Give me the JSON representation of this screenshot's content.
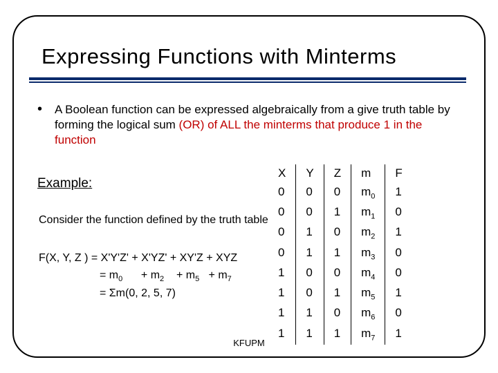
{
  "title": "Expressing Functions with Minterms",
  "bullet": {
    "pre": "A Boolean function can be expressed algebraically from a give truth table by forming the logical sum ",
    "or": "(OR) of ALL the minterms that produce ",
    "one": "1 in the function"
  },
  "example_label": "Example:",
  "consider": "Consider the function defined by the truth table",
  "fx": {
    "line1": "F(X, Y, Z ) =  X'Y'Z' + X'YZ' + XY'Z + XYZ",
    "line2_pre": "= m",
    "line2_s0": "0",
    "line2_mid1": "      + m",
    "line2_s2": "2",
    "line2_mid2": "    + m",
    "line2_s5": "5",
    "line2_mid3": "   + m",
    "line2_s7": "7",
    "line3": "= Σm(0, 2, 5, 7)"
  },
  "table": {
    "headers": [
      "X",
      "Y",
      "Z",
      "m",
      "F"
    ],
    "rows": [
      {
        "x": "0",
        "y": "0",
        "z": "0",
        "m": "m",
        "mi": "0",
        "f": "1"
      },
      {
        "x": "0",
        "y": "0",
        "z": "1",
        "m": "m",
        "mi": "1",
        "f": "0"
      },
      {
        "x": "0",
        "y": "1",
        "z": "0",
        "m": "m",
        "mi": "2",
        "f": "1"
      },
      {
        "x": "0",
        "y": "1",
        "z": "1",
        "m": "m",
        "mi": "3",
        "f": "0"
      },
      {
        "x": "1",
        "y": "0",
        "z": "0",
        "m": "m",
        "mi": "4",
        "f": "0"
      },
      {
        "x": "1",
        "y": "0",
        "z": "1",
        "m": "m",
        "mi": "5",
        "f": "1"
      },
      {
        "x": "1",
        "y": "1",
        "z": "0",
        "m": "m",
        "mi": "6",
        "f": "0"
      },
      {
        "x": "1",
        "y": "1",
        "z": "1",
        "m": "m",
        "mi": "7",
        "f": "1"
      }
    ]
  },
  "footer": "KFUPM"
}
